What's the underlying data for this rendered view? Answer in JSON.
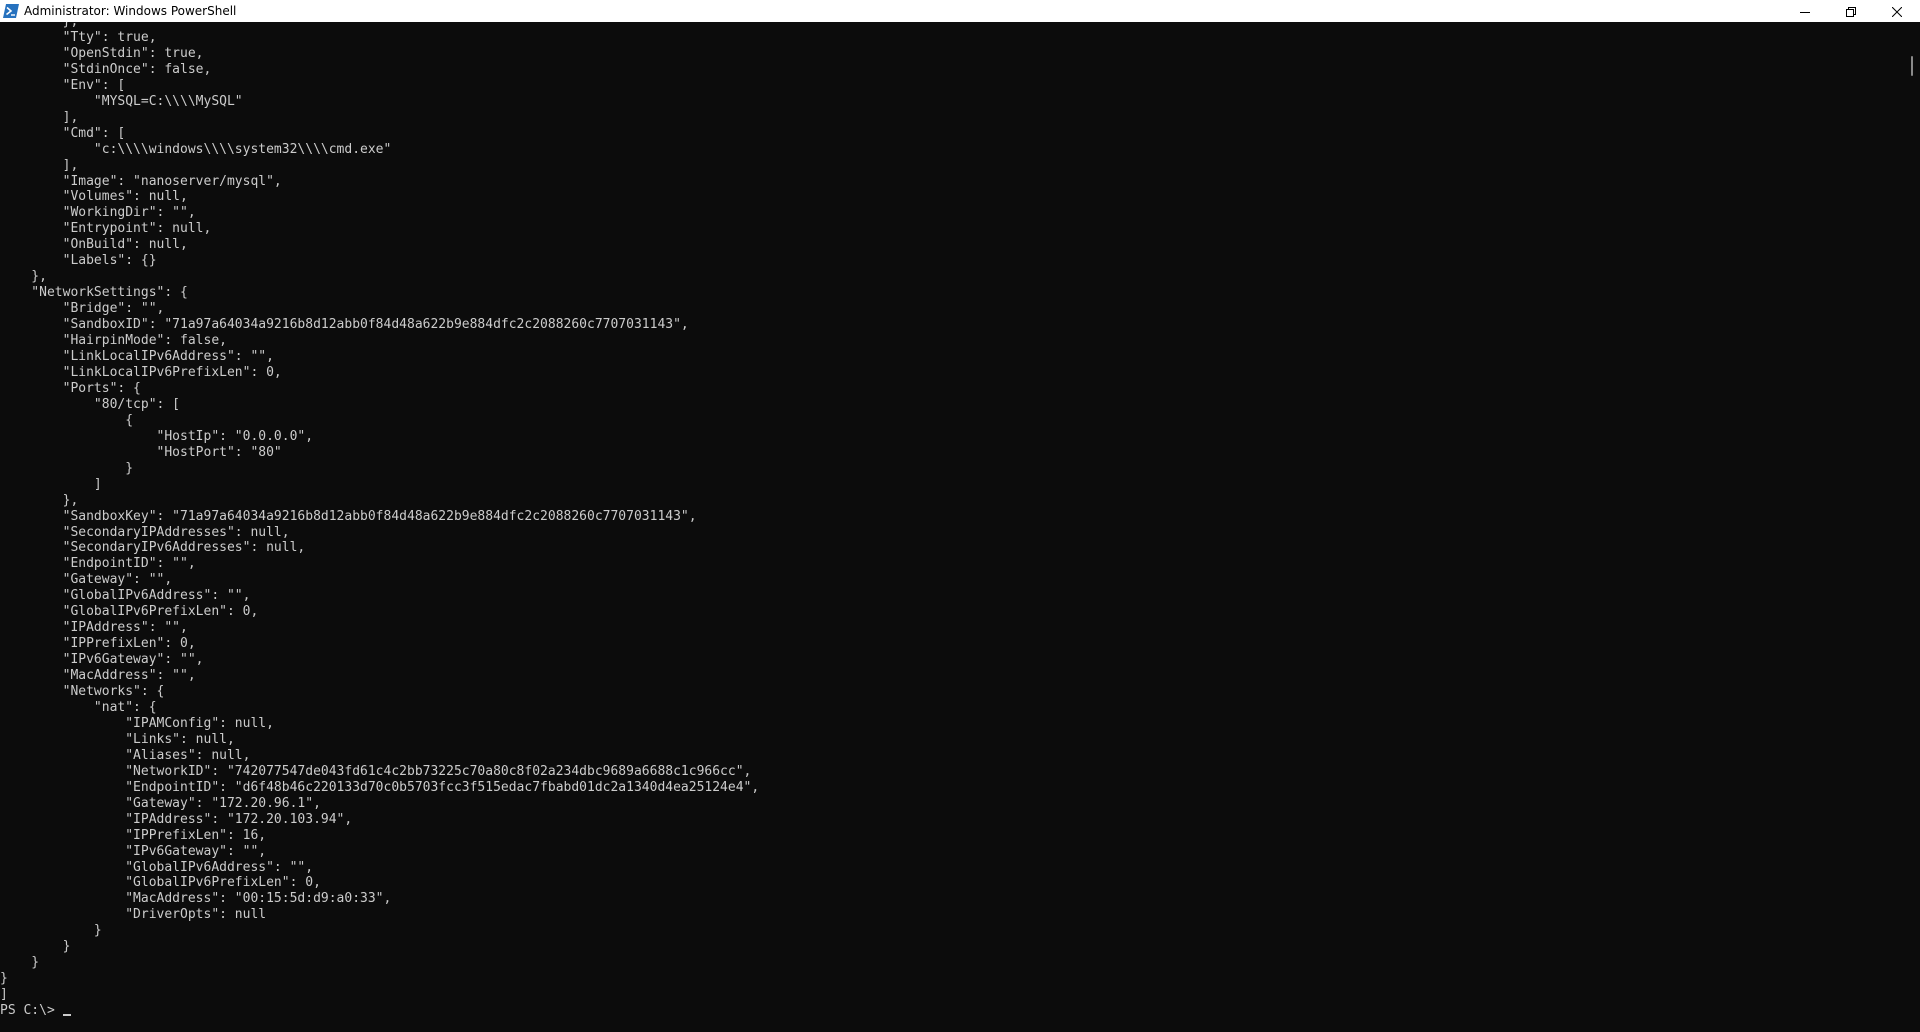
{
  "window": {
    "title": "Administrator: Windows PowerShell",
    "app_icon": "powershell-icon",
    "controls": {
      "minimize": "minimize-icon",
      "maximize": "restore-icon",
      "close": "close-icon"
    }
  },
  "terminal": {
    "output": "        },\n        \"Tty\": true,\n        \"OpenStdin\": true,\n        \"StdinOnce\": false,\n        \"Env\": [\n            \"MYSQL=C:\\\\\\\\MySQL\"\n        ],\n        \"Cmd\": [\n            \"c:\\\\\\\\windows\\\\\\\\system32\\\\\\\\cmd.exe\"\n        ],\n        \"Image\": \"nanoserver/mysql\",\n        \"Volumes\": null,\n        \"WorkingDir\": \"\",\n        \"Entrypoint\": null,\n        \"OnBuild\": null,\n        \"Labels\": {}\n    },\n    \"NetworkSettings\": {\n        \"Bridge\": \"\",\n        \"SandboxID\": \"71a97a64034a9216b8d12abb0f84d48a622b9e884dfc2c2088260c7707031143\",\n        \"HairpinMode\": false,\n        \"LinkLocalIPv6Address\": \"\",\n        \"LinkLocalIPv6PrefixLen\": 0,\n        \"Ports\": {\n            \"80/tcp\": [\n                {\n                    \"HostIp\": \"0.0.0.0\",\n                    \"HostPort\": \"80\"\n                }\n            ]\n        },\n        \"SandboxKey\": \"71a97a64034a9216b8d12abb0f84d48a622b9e884dfc2c2088260c7707031143\",\n        \"SecondaryIPAddresses\": null,\n        \"SecondaryIPv6Addresses\": null,\n        \"EndpointID\": \"\",\n        \"Gateway\": \"\",\n        \"GlobalIPv6Address\": \"\",\n        \"GlobalIPv6PrefixLen\": 0,\n        \"IPAddress\": \"\",\n        \"IPPrefixLen\": 0,\n        \"IPv6Gateway\": \"\",\n        \"MacAddress\": \"\",\n        \"Networks\": {\n            \"nat\": {\n                \"IPAMConfig\": null,\n                \"Links\": null,\n                \"Aliases\": null,\n                \"NetworkID\": \"742077547de043fd61c4c2bb73225c70a80c8f02a234dbc9689a6688c1c966cc\",\n                \"EndpointID\": \"d6f48b46c220133d70c0b5703fcc3f515edac7fbabd01dc2a1340d4ea25124e4\",\n                \"Gateway\": \"172.20.96.1\",\n                \"IPAddress\": \"172.20.103.94\",\n                \"IPPrefixLen\": 16,\n                \"IPv6Gateway\": \"\",\n                \"GlobalIPv6Address\": \"\",\n                \"GlobalIPv6PrefixLen\": 0,\n                \"MacAddress\": \"00:15:5d:d9:a0:33\",\n                \"DriverOpts\": null\n            }\n        }\n    }\n}\n]",
    "prompt": "PS C:\\>"
  },
  "colors": {
    "background": "#0c0c0c",
    "foreground": "#cccccc",
    "titlebar": "#ffffff",
    "powershell_blue": "#2671be"
  }
}
